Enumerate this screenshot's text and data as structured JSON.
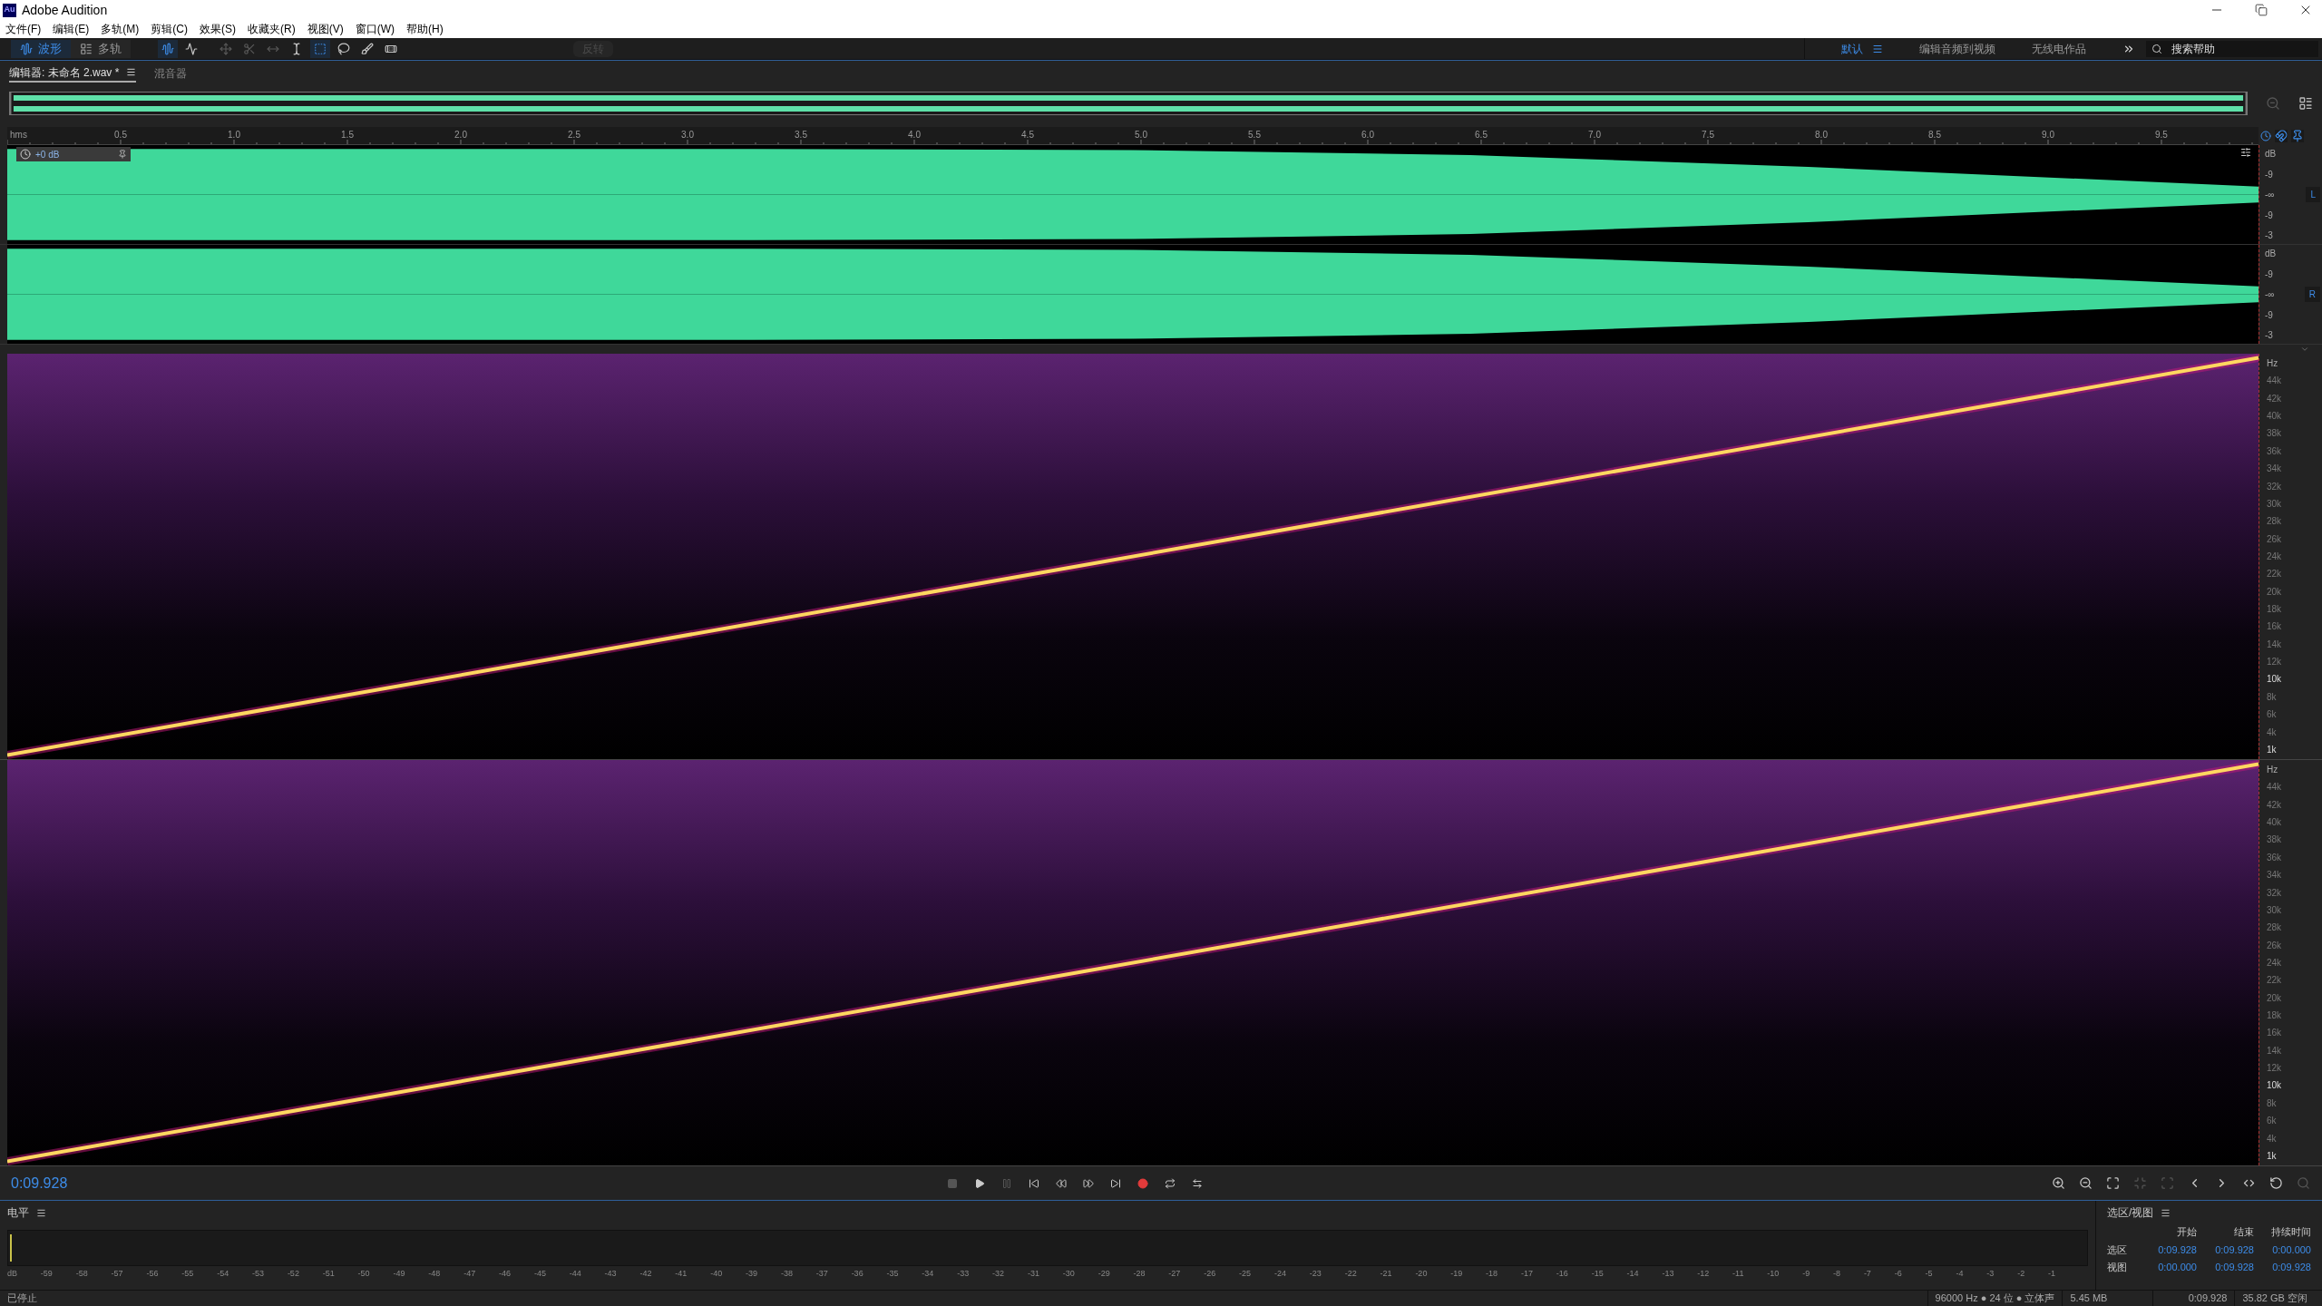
{
  "window": {
    "title": "Adobe Audition",
    "logo": "Au"
  },
  "menu": [
    "文件(F)",
    "编辑(E)",
    "多轨(M)",
    "剪辑(C)",
    "效果(S)",
    "收藏夹(R)",
    "视图(V)",
    "窗口(W)",
    "帮助(H)"
  ],
  "view_modes": [
    {
      "label": "波形",
      "kind": "waveform",
      "selected": true
    },
    {
      "label": "多轨",
      "kind": "multitrack",
      "selected": false
    }
  ],
  "tools": [
    {
      "kind": "waveform-view",
      "selected": true,
      "disabled": false
    },
    {
      "kind": "spectral-view",
      "selected": false,
      "disabled": false
    },
    {
      "kind": "move",
      "selected": false,
      "disabled": true
    },
    {
      "kind": "razor",
      "selected": false,
      "disabled": true
    },
    {
      "kind": "slip",
      "selected": false,
      "disabled": true
    },
    {
      "kind": "time-selection",
      "selected": false,
      "disabled": false
    },
    {
      "kind": "marquee",
      "selected": true,
      "disabled": false
    },
    {
      "kind": "lasso",
      "selected": false,
      "disabled": false
    },
    {
      "kind": "brush",
      "selected": false,
      "disabled": false
    },
    {
      "kind": "healing",
      "selected": false,
      "disabled": false
    }
  ],
  "invert_button": {
    "label": "反转",
    "disabled": true
  },
  "workspaces": [
    {
      "label": "默认",
      "selected": true
    },
    {
      "label": "编辑音频到视频",
      "selected": false
    },
    {
      "label": "无线电作品",
      "selected": false
    }
  ],
  "search": {
    "placeholder": "搜索帮助"
  },
  "panel_tabs": [
    {
      "label": "编辑器: 未命名 2.wav *",
      "selected": true
    },
    {
      "label": "混音器",
      "selected": false
    }
  ],
  "ruler": {
    "unit": "hms",
    "labels": [
      "0.5",
      "1.0",
      "1.5",
      "2.0",
      "2.5",
      "3.0",
      "3.5",
      "4.0",
      "4.5",
      "5.0",
      "5.5",
      "6.0",
      "6.5",
      "7.0",
      "7.5",
      "8.0",
      "8.5",
      "9.0",
      "9.5"
    ]
  },
  "hud": {
    "gain": "+0 dB"
  },
  "channels": [
    {
      "label": "L",
      "scale": [
        "dB",
        "-9",
        "-∞",
        "-9",
        "-3"
      ]
    },
    {
      "label": "R",
      "scale": [
        "dB",
        "-9",
        "-∞",
        "-9",
        "-3"
      ]
    }
  ],
  "spectral_scales": [
    [
      {
        "label": "Hz",
        "kind": "unit"
      },
      {
        "label": "44k",
        "kind": "minor"
      },
      {
        "label": "42k",
        "kind": "minor"
      },
      {
        "label": "40k",
        "kind": "minor"
      },
      {
        "label": "38k",
        "kind": "minor"
      },
      {
        "label": "36k",
        "kind": "minor"
      },
      {
        "label": "34k",
        "kind": "minor"
      },
      {
        "label": "32k",
        "kind": "minor"
      },
      {
        "label": "30k",
        "kind": "minor"
      },
      {
        "label": "28k",
        "kind": "minor"
      },
      {
        "label": "26k",
        "kind": "minor"
      },
      {
        "label": "24k",
        "kind": "minor"
      },
      {
        "label": "22k",
        "kind": "minor"
      },
      {
        "label": "20k",
        "kind": "minor"
      },
      {
        "label": "18k",
        "kind": "minor"
      },
      {
        "label": "16k",
        "kind": "minor"
      },
      {
        "label": "14k",
        "kind": "minor"
      },
      {
        "label": "12k",
        "kind": "minor"
      },
      {
        "label": "10k",
        "kind": "major"
      },
      {
        "label": "8k",
        "kind": "minor"
      },
      {
        "label": "6k",
        "kind": "minor"
      },
      {
        "label": "4k",
        "kind": "minor"
      },
      {
        "label": "1k",
        "kind": "major"
      }
    ],
    [
      {
        "label": "Hz",
        "kind": "unit"
      },
      {
        "label": "44k",
        "kind": "minor"
      },
      {
        "label": "42k",
        "kind": "minor"
      },
      {
        "label": "40k",
        "kind": "minor"
      },
      {
        "label": "38k",
        "kind": "minor"
      },
      {
        "label": "36k",
        "kind": "minor"
      },
      {
        "label": "34k",
        "kind": "minor"
      },
      {
        "label": "32k",
        "kind": "minor"
      },
      {
        "label": "30k",
        "kind": "minor"
      },
      {
        "label": "28k",
        "kind": "minor"
      },
      {
        "label": "26k",
        "kind": "minor"
      },
      {
        "label": "24k",
        "kind": "minor"
      },
      {
        "label": "22k",
        "kind": "minor"
      },
      {
        "label": "20k",
        "kind": "minor"
      },
      {
        "label": "18k",
        "kind": "minor"
      },
      {
        "label": "16k",
        "kind": "minor"
      },
      {
        "label": "14k",
        "kind": "minor"
      },
      {
        "label": "12k",
        "kind": "minor"
      },
      {
        "label": "10k",
        "kind": "major"
      },
      {
        "label": "8k",
        "kind": "minor"
      },
      {
        "label": "6k",
        "kind": "minor"
      },
      {
        "label": "4k",
        "kind": "minor"
      },
      {
        "label": "1k",
        "kind": "major"
      }
    ]
  ],
  "time_display": "0:09.928",
  "transport": [
    {
      "kind": "stop",
      "disabled": true
    },
    {
      "kind": "play",
      "disabled": false
    },
    {
      "kind": "pause",
      "disabled": true
    },
    {
      "kind": "to-start",
      "disabled": false
    },
    {
      "kind": "rewind",
      "disabled": false
    },
    {
      "kind": "fast-forward",
      "disabled": false
    },
    {
      "kind": "to-end",
      "disabled": false
    },
    {
      "kind": "record",
      "disabled": false
    },
    {
      "kind": "loop",
      "disabled": false
    },
    {
      "kind": "skip",
      "disabled": false
    }
  ],
  "zoom_tools": [
    {
      "kind": "zoom-in-amp",
      "disabled": false
    },
    {
      "kind": "zoom-out-amp",
      "disabled": false
    },
    {
      "kind": "zoom-in-time",
      "disabled": false
    },
    {
      "kind": "zoom-out-full",
      "disabled": true
    },
    {
      "kind": "zoom-selection",
      "disabled": true
    },
    {
      "kind": "zoom-in-start",
      "disabled": false
    },
    {
      "kind": "zoom-in-end",
      "disabled": false
    },
    {
      "kind": "zoom-both",
      "disabled": false
    },
    {
      "kind": "zoom-reset",
      "disabled": false
    },
    {
      "kind": "zoom-marker",
      "disabled": true
    }
  ],
  "levels": {
    "title": "电平",
    "scale": [
      "dB",
      "-59",
      "-58",
      "-57",
      "-56",
      "-55",
      "-54",
      "-53",
      "-52",
      "-51",
      "-50",
      "-49",
      "-48",
      "-47",
      "-46",
      "-45",
      "-44",
      "-43",
      "-42",
      "-41",
      "-40",
      "-39",
      "-38",
      "-37",
      "-36",
      "-35",
      "-34",
      "-33",
      "-32",
      "-31",
      "-30",
      "-29",
      "-28",
      "-27",
      "-26",
      "-25",
      "-24",
      "-23",
      "-22",
      "-21",
      "-20",
      "-19",
      "-18",
      "-17",
      "-16",
      "-15",
      "-14",
      "-13",
      "-12",
      "-11",
      "-10",
      "-9",
      "-8",
      "-7",
      "-6",
      "-5",
      "-4",
      "-3",
      "-2",
      "-1"
    ]
  },
  "selection_view": {
    "title": "选区/视图",
    "columns": [
      "开始",
      "结束",
      "持续时间"
    ],
    "rows": [
      {
        "label": "选区",
        "cells": [
          "0:09.928",
          "0:09.928",
          "0:00.000"
        ]
      },
      {
        "label": "视图",
        "cells": [
          "0:00.000",
          "0:09.928",
          "0:09.928"
        ]
      }
    ]
  },
  "status_bar": {
    "state": "已停止",
    "format": "96000 Hz ● 24 位 ● 立体声",
    "size": "5.45 MB",
    "duration": "0:09.928",
    "free": "35.82 GB 空闲"
  }
}
